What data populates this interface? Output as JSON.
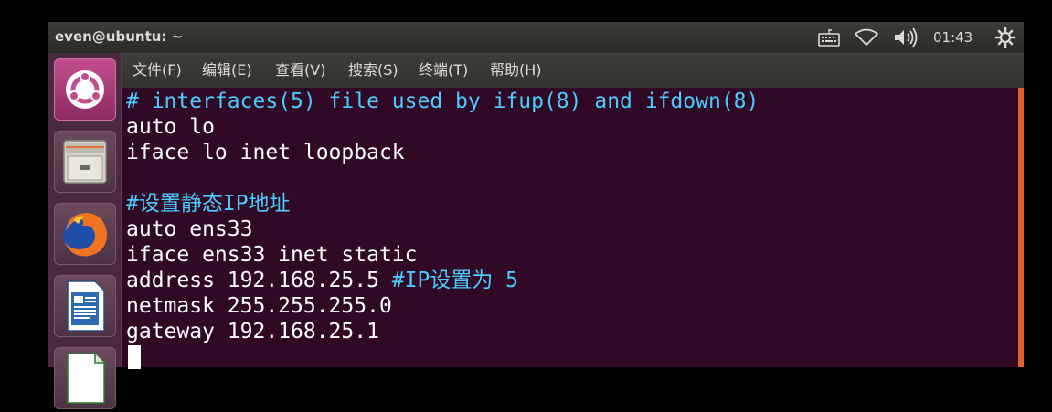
{
  "panel": {
    "title": "even@ubuntu: ~",
    "clock": "01:43",
    "icons": [
      "keyboard-icon",
      "wifi-icon",
      "volume-icon",
      "gear-icon"
    ]
  },
  "launcher": {
    "items": [
      "dash-home",
      "files",
      "firefox",
      "libreoffice-writer",
      "libreoffice-calc"
    ]
  },
  "menu": {
    "file": "文件(F)",
    "edit": "编辑(E)",
    "view": "查看(V)",
    "search": "搜索(S)",
    "terminal": "终端(T)",
    "help": "帮助(H)"
  },
  "terminal": {
    "lines": [
      "# interfaces(5) file used by ifup(8) and ifdown(8)",
      "auto lo",
      "iface lo inet loopback",
      "",
      "#设置静态IP地址",
      "auto ens33",
      "iface ens33 inet static",
      "address 192.168.25.5 ",
      "netmask 255.255.255.0",
      "gateway 192.168.25.1"
    ],
    "address_comment": "#IP设置为 5"
  },
  "colors": {
    "terminal_bg": "#300a24",
    "comment": "#4bcbff",
    "text": "#ffffff",
    "launcher_bg": "#4a2a3e",
    "scrollbar": "#e0642a"
  }
}
